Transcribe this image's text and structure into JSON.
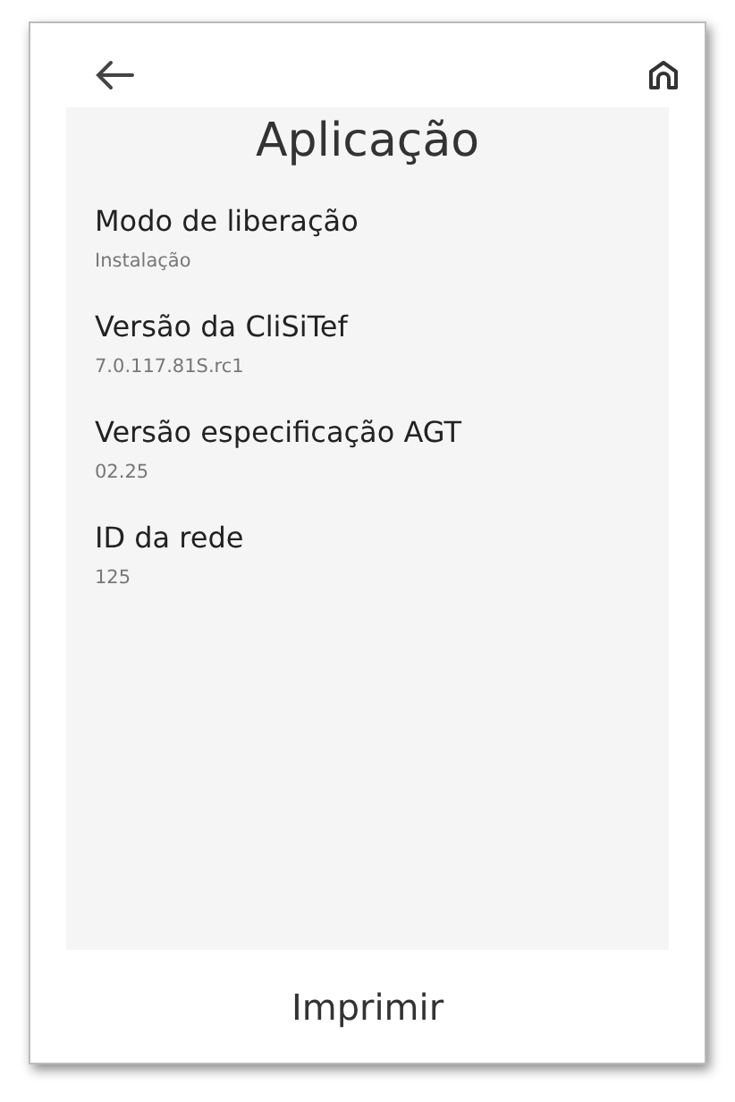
{
  "title": "Aplicação",
  "fields": [
    {
      "label": "Modo de liberação",
      "value": "Instalação"
    },
    {
      "label": "Versão da CliSiTef",
      "value": "7.0.117.81S.rc1"
    },
    {
      "label": "Versão especificação AGT",
      "value": "02.25"
    },
    {
      "label": "ID da rede",
      "value": "125"
    }
  ],
  "print_button": "Imprimir"
}
